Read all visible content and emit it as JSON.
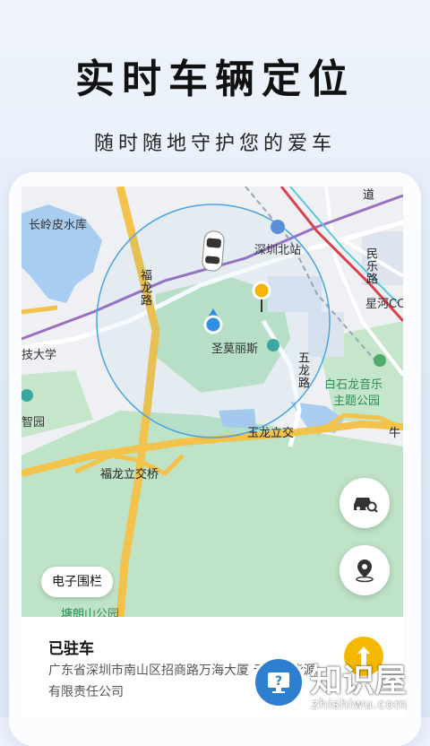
{
  "hero": {
    "title": "实时车辆定位",
    "subtitle": "随时随地守护您的爱车"
  },
  "map": {
    "labels": {
      "reservoir": "长岭皮水库",
      "fulong_road": "福龙路",
      "university": "技大学",
      "zhiyuan": "智园",
      "station": "深圳北站",
      "minle_road": "民乐路",
      "xinghe": "星河CO",
      "road_dao": "道",
      "shengmo": "圣莫丽斯",
      "wulong_road": "五龙路",
      "baishilong": "白石龙音乐",
      "theme_park": "主题公园",
      "yulong_interchange": "玉龙立交",
      "niu": "牛",
      "fulong_interchange": "福龙立交桥",
      "tangyuan": "塘朗山公园"
    },
    "colors": {
      "green": "#bfe3c6",
      "water": "#a9cdf0",
      "road_major": "#f2c24b",
      "road_minor": "#ffffff",
      "metro_purple": "#9b6fc0",
      "metro_red": "#d9414b",
      "range_circle": "#4aa3e0"
    }
  },
  "controls": {
    "car_search_icon": "car-search-icon",
    "location_icon": "location-pin-icon",
    "fence_label": "电子围栏"
  },
  "info": {
    "status": "已驻车",
    "address": "广东省深圳市南山区招商路万海大厦 云度新能源有限责任公司",
    "nav_icon": "navigation-arrow-icon"
  },
  "watermark": {
    "brand": "知识屋",
    "url": "zhishiwu.com"
  }
}
